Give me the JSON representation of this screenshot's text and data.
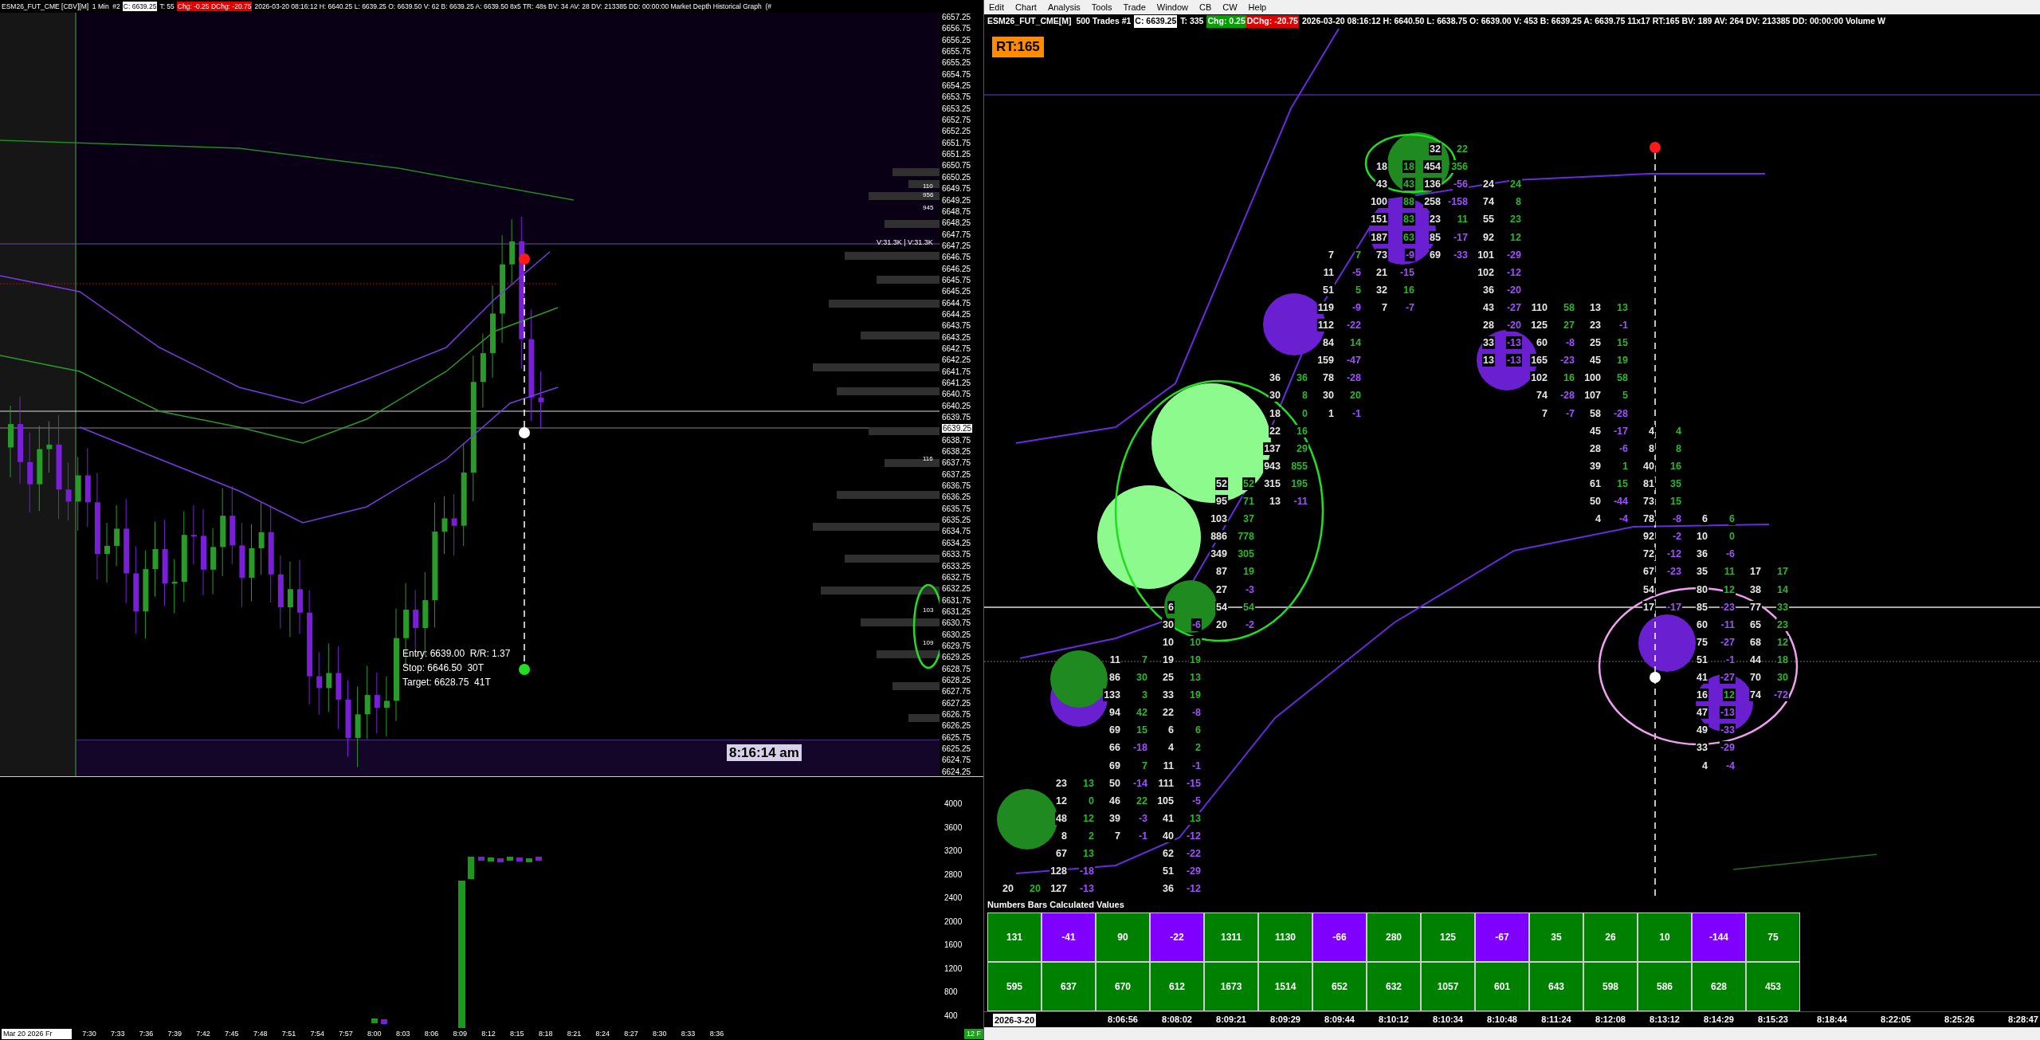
{
  "left_chart": {
    "header": {
      "symbol": "ESM26_FUT_CME [CBV][M]  1 Min  #2",
      "close": "C: 6639.25",
      "trades": "T: 55",
      "change": "Chg: -0.25 DChg: -20.75",
      "details": "2026-03-20 08:16:12 H: 6640.25 L: 6639.25 O: 6639.50 V: 62 B: 6639.25 A: 6639.50 8x5 TR: 48s BV: 34 AV: 28 DV: 213385 DD: 00:00:00 Market Depth Historical Graph  (#"
    },
    "price_axis": [
      {
        "text": "6657.25",
        "highlighted": false
      },
      {
        "text": "6656.75",
        "highlighted": false
      },
      {
        "text": "6656.25",
        "highlighted": false
      },
      {
        "text": "6655.75",
        "highlighted": false
      },
      {
        "text": "6655.25",
        "highlighted": false
      },
      {
        "text": "6654.75",
        "highlighted": false
      },
      {
        "text": "6654.25",
        "highlighted": false
      },
      {
        "text": "6653.75",
        "highlighted": false
      },
      {
        "text": "6653.25",
        "highlighted": false
      },
      {
        "text": "6652.75",
        "highlighted": false
      },
      {
        "text": "6652.25",
        "highlighted": false
      },
      {
        "text": "6651.75",
        "highlighted": false
      },
      {
        "text": "6651.25",
        "highlighted": false
      },
      {
        "text": "6650.75",
        "highlighted": false
      },
      {
        "text": "6650.25",
        "highlighted": false
      },
      {
        "text": "6649.75",
        "highlighted": false
      },
      {
        "text": "6649.25",
        "highlighted": false
      },
      {
        "text": "6648.75",
        "highlighted": false
      },
      {
        "text": "6648.25",
        "highlighted": false
      },
      {
        "text": "6647.75",
        "highlighted": false
      },
      {
        "text": "6647.25",
        "highlighted": false
      },
      {
        "text": "6646.75",
        "highlighted": false
      },
      {
        "text": "6646.25",
        "highlighted": false
      },
      {
        "text": "6645.75",
        "highlighted": false
      },
      {
        "text": "6645.25",
        "highlighted": false
      },
      {
        "text": "6644.75",
        "highlighted": false
      },
      {
        "text": "6644.25",
        "highlighted": false
      },
      {
        "text": "6643.75",
        "highlighted": false
      },
      {
        "text": "6643.25",
        "highlighted": false
      },
      {
        "text": "6642.75",
        "highlighted": false
      },
      {
        "text": "6642.25",
        "highlighted": false
      },
      {
        "text": "6641.75",
        "highlighted": false
      },
      {
        "text": "6641.25",
        "highlighted": false
      },
      {
        "text": "6640.75",
        "highlighted": false
      },
      {
        "text": "6640.25",
        "highlighted": false
      },
      {
        "text": "6639.75",
        "highlighted": false
      },
      {
        "text": "6639.25",
        "highlighted": true
      },
      {
        "text": "6638.75",
        "highlighted": false
      },
      {
        "text": "6638.25",
        "highlighted": false
      },
      {
        "text": "6637.75",
        "highlighted": false
      },
      {
        "text": "6637.25",
        "highlighted": false
      },
      {
        "text": "6636.75",
        "highlighted": false
      },
      {
        "text": "6636.25",
        "highlighted": false
      },
      {
        "text": "6635.75",
        "highlighted": false
      },
      {
        "text": "6635.25",
        "highlighted": false
      },
      {
        "text": "6634.75",
        "highlighted": false
      },
      {
        "text": "6634.25",
        "highlighted": false
      },
      {
        "text": "6633.75",
        "highlighted": false
      },
      {
        "text": "6633.25",
        "highlighted": false
      },
      {
        "text": "6632.75",
        "highlighted": false
      },
      {
        "text": "6632.25",
        "highlighted": false
      },
      {
        "text": "6631.75",
        "highlighted": false
      },
      {
        "text": "6631.25",
        "highlighted": false
      },
      {
        "text": "6630.75",
        "highlighted": false
      },
      {
        "text": "6630.25",
        "highlighted": false
      },
      {
        "text": "6629.75",
        "highlighted": false
      },
      {
        "text": "6629.25",
        "highlighted": false
      },
      {
        "text": "6628.75",
        "highlighted": false
      },
      {
        "text": "6628.25",
        "highlighted": false
      },
      {
        "text": "6627.75",
        "highlighted": false
      },
      {
        "text": "6627.25",
        "highlighted": false
      },
      {
        "text": "6626.75",
        "highlighted": false
      },
      {
        "text": "6626.25",
        "highlighted": false
      },
      {
        "text": "6625.75",
        "highlighted": false
      },
      {
        "text": "6625.25",
        "highlighted": false
      },
      {
        "text": "6624.75",
        "highlighted": false
      },
      {
        "text": "6624.25",
        "highlighted": false
      }
    ],
    "depth_labels": [
      "110",
      "956",
      "945",
      "116",
      "103",
      "109"
    ],
    "volume_label": "V:31.3K | V:31.3K",
    "order_info": [
      "Entry: 6639.00  R/R: 1.37",
      "Stop: 6646.50  30T",
      "Target: 6628.75  41T"
    ],
    "time_box": "8:16:14 am",
    "volume_axis": [
      "4000",
      "3600",
      "3200",
      "2800",
      "2400",
      "2000",
      "1600",
      "1200",
      "800",
      "400"
    ],
    "time_axis": {
      "date": "Mar 20 2026 Fr",
      "times": [
        "7:30",
        "7:33",
        "7:36",
        "7:39",
        "7:42",
        "7:45",
        "7:48",
        "7:51",
        "7:54",
        "7:57",
        "8:00",
        "8:03",
        "8:06",
        "8:09",
        "8:12",
        "8:15",
        "8:18",
        "8:21",
        "8:24",
        "8:27",
        "8:30",
        "8:33",
        "8:36"
      ],
      "tag": "12 F"
    }
  },
  "right_chart": {
    "menu": [
      "Edit",
      "Chart",
      "Analysis",
      "Tools",
      "Trade",
      "Window",
      "CB",
      "CW",
      "Help"
    ],
    "header": {
      "symbol": "ESM26_FUT_CME[M]  500 Trades #1",
      "close": "C: 6639.25",
      "trades": "T: 335",
      "change": "Chg: 0.25",
      "daily_change": "DChg: -20.75",
      "details": "2026-03-20 08:16:12 H: 6640.50 L: 6638.75 O: 6639.00 V: 453 B: 6639.25 A: 6639.75 11x17 RT:165 BV: 189 AV: 264 DV: 213385 DD: 00:00:00 Volume W"
    },
    "rt_badge": "RT:165",
    "bars": [
      {
        "cells": [
          null,
          null,
          null,
          null,
          null,
          null,
          null,
          null,
          null,
          null,
          null,
          null,
          null,
          null,
          null,
          null,
          null,
          null,
          null,
          null,
          null,
          null,
          null,
          null,
          null,
          null,
          null,
          null,
          null,
          null,
          null,
          null,
          null,
          null,
          null,
          null,
          null,
          null,
          null,
          null,
          null,
          null,
          [
            "20",
            "20",
            true
          ]
        ]
      },
      {
        "cells": [
          null,
          null,
          null,
          null,
          null,
          null,
          null,
          null,
          null,
          null,
          null,
          null,
          null,
          null,
          null,
          null,
          null,
          null,
          null,
          null,
          null,
          null,
          null,
          null,
          null,
          null,
          null,
          null,
          null,
          null,
          null,
          null,
          null,
          null,
          null,
          null,
          [
            "23",
            "13",
            true
          ],
          [
            "12",
            "0",
            true
          ],
          [
            "48",
            "12",
            true
          ],
          [
            "8",
            "2",
            true
          ],
          [
            "67",
            "13",
            true
          ],
          [
            "128",
            "-18",
            false
          ],
          [
            "127",
            "-13",
            false
          ]
        ]
      },
      {
        "cells": [
          null,
          null,
          null,
          null,
          null,
          null,
          null,
          null,
          null,
          null,
          null,
          null,
          null,
          null,
          null,
          null,
          null,
          null,
          null,
          null,
          null,
          null,
          null,
          null,
          null,
          null,
          null,
          null,
          null,
          [
            "11",
            "7",
            true
          ],
          [
            "86",
            "30",
            true
          ],
          [
            "133",
            "3",
            true
          ],
          [
            "94",
            "42",
            true
          ],
          [
            "69",
            "15",
            true
          ],
          [
            "66",
            "-18",
            false
          ],
          [
            "69",
            "7",
            true
          ],
          [
            "50",
            "-14",
            false
          ],
          [
            "46",
            "22",
            true
          ],
          [
            "39",
            "-3",
            false
          ],
          [
            "7",
            "-1",
            false
          ]
        ]
      },
      {
        "cells": [
          null,
          null,
          null,
          null,
          null,
          null,
          null,
          null,
          null,
          null,
          null,
          null,
          null,
          null,
          null,
          null,
          null,
          null,
          null,
          null,
          null,
          null,
          null,
          null,
          null,
          null,
          [
            "6"
          ],
          [
            "30",
            "-6",
            false
          ],
          [
            "10",
            "10",
            true
          ],
          [
            "19",
            "19",
            true
          ],
          [
            "25",
            "13",
            true
          ],
          [
            "33",
            "19",
            true
          ],
          [
            "22",
            "-8",
            false
          ],
          [
            "6",
            "6",
            true
          ],
          [
            "4",
            "2",
            true
          ],
          [
            "11",
            "-1",
            false
          ],
          [
            "111",
            "-15",
            false
          ],
          [
            "105",
            "-5",
            false
          ],
          [
            "41",
            "13",
            true
          ],
          [
            "40",
            "-12",
            false
          ],
          [
            "62",
            "-22",
            false
          ],
          [
            "51",
            "-29",
            false
          ],
          [
            "36",
            "-12",
            false
          ]
        ]
      },
      {
        "cells": [
          null,
          null,
          null,
          null,
          null,
          null,
          null,
          null,
          null,
          null,
          null,
          null,
          null,
          null,
          null,
          null,
          null,
          null,
          null,
          [
            "52",
            "52",
            true
          ],
          [
            "95",
            "71",
            true
          ],
          [
            "103",
            "37",
            true
          ],
          [
            "886",
            "778",
            true
          ],
          [
            "349",
            "305",
            true
          ],
          [
            "87",
            "19",
            true
          ],
          [
            "27",
            "-3",
            false
          ],
          [
            "54",
            "54",
            true
          ],
          [
            "20",
            "-2",
            false
          ]
        ]
      },
      {
        "cells": [
          null,
          null,
          null,
          null,
          null,
          null,
          null,
          null,
          null,
          null,
          null,
          null,
          null,
          [
            "36",
            "36",
            true
          ],
          [
            "30",
            "8",
            true
          ],
          [
            "18",
            "0",
            true
          ],
          [
            "22",
            "16",
            true
          ],
          [
            "137",
            "29",
            true
          ],
          [
            "943",
            "855",
            true
          ],
          [
            "315",
            "195",
            true
          ],
          [
            "13",
            "-11",
            false
          ]
        ]
      },
      {
        "cells": [
          null,
          null,
          null,
          null,
          null,
          null,
          [
            "7",
            "7",
            true
          ],
          [
            "11",
            "-5",
            false
          ],
          [
            "51",
            "5",
            true
          ],
          [
            "119",
            "-9",
            false
          ],
          [
            "112",
            "-22",
            false
          ],
          [
            "84",
            "14",
            true
          ],
          [
            "159",
            "-47",
            false
          ],
          [
            "78",
            "-28",
            false
          ],
          [
            "30",
            "20",
            true
          ],
          [
            "1",
            "-1",
            false
          ]
        ]
      },
      {
        "cells": [
          null,
          [
            "18",
            "18",
            true
          ],
          [
            "43",
            "43",
            true
          ],
          [
            "100",
            "88",
            true
          ],
          [
            "151",
            "83",
            true
          ],
          [
            "187",
            "63",
            true
          ],
          [
            "73",
            "-9",
            false
          ],
          [
            "21",
            "-15",
            false
          ],
          [
            "32",
            "16",
            true
          ],
          [
            "7",
            "-7",
            false
          ]
        ]
      },
      {
        "cells": [
          [
            "32",
            "22",
            true
          ],
          [
            "454",
            "356",
            true
          ],
          [
            "136",
            "-56",
            false
          ],
          [
            "258",
            "-158",
            false
          ],
          [
            "23",
            "11",
            true
          ],
          [
            "85",
            "-17",
            false
          ],
          [
            "69",
            "-33",
            false
          ]
        ]
      },
      {
        "cells": [
          null,
          null,
          [
            "24",
            "24",
            true
          ],
          [
            "74",
            "8",
            true
          ],
          [
            "55",
            "23",
            true
          ],
          [
            "92",
            "12",
            true
          ],
          [
            "101",
            "-29",
            false
          ],
          [
            "102",
            "-12",
            false
          ],
          [
            "36",
            "-20",
            false
          ],
          [
            "43",
            "-27",
            false
          ],
          [
            "28",
            "-20",
            false
          ],
          [
            "33",
            "-13",
            false
          ],
          [
            "13",
            "-13",
            false
          ]
        ]
      },
      {
        "cells": [
          null,
          null,
          null,
          null,
          null,
          null,
          null,
          null,
          null,
          [
            "110",
            "58",
            true
          ],
          [
            "125",
            "27",
            true
          ],
          [
            "60",
            "-8",
            false
          ],
          [
            "165",
            "-23",
            false
          ],
          [
            "102",
            "16",
            true
          ],
          [
            "74",
            "-28",
            false
          ],
          [
            "7",
            "-7",
            false
          ]
        ]
      },
      {
        "cells": [
          null,
          null,
          null,
          null,
          null,
          null,
          null,
          null,
          null,
          [
            "13",
            "13",
            true
          ],
          [
            "23",
            "-1",
            false
          ],
          [
            "25",
            "15",
            true
          ],
          [
            "45",
            "19",
            true
          ],
          [
            "100",
            "58",
            true
          ],
          [
            "107",
            "5",
            true
          ],
          [
            "58",
            "-28",
            false
          ],
          [
            "45",
            "-17",
            false
          ],
          [
            "28",
            "-6",
            false
          ],
          [
            "39",
            "1",
            true
          ],
          [
            "61",
            "15",
            true
          ],
          [
            "50",
            "-44",
            false
          ],
          [
            "4",
            "-4",
            false
          ]
        ]
      },
      {
        "cells": [
          null,
          null,
          null,
          null,
          null,
          null,
          null,
          null,
          null,
          null,
          null,
          null,
          null,
          null,
          null,
          null,
          [
            "4",
            "4",
            true
          ],
          [
            "8",
            "8",
            true
          ],
          [
            "40",
            "16",
            true
          ],
          [
            "81",
            "35",
            true
          ],
          [
            "73",
            "15",
            true
          ],
          [
            "78",
            "-8",
            false
          ],
          [
            "92",
            "-2",
            false
          ],
          [
            "72",
            "-12",
            false
          ],
          [
            "67",
            "-23",
            false
          ],
          [
            "54"
          ],
          [
            "17",
            "-17",
            false
          ]
        ]
      },
      {
        "cells": [
          null,
          null,
          null,
          null,
          null,
          null,
          null,
          null,
          null,
          null,
          null,
          null,
          null,
          null,
          null,
          null,
          null,
          null,
          null,
          null,
          null,
          [
            "6",
            "6",
            true
          ],
          [
            "10",
            "0",
            true
          ],
          [
            "36",
            "-6",
            false
          ],
          [
            "35",
            "11",
            true
          ],
          [
            "80",
            "12",
            true
          ],
          [
            "85",
            "-23",
            false
          ],
          [
            "60",
            "-11",
            false
          ],
          [
            "75",
            "-27",
            false
          ],
          [
            "51",
            "-1",
            false
          ],
          [
            "41",
            "-27",
            false
          ],
          [
            "16",
            "12",
            true
          ],
          [
            "47",
            "-13",
            false
          ],
          [
            "49",
            "-33",
            false
          ],
          [
            "33",
            "-29",
            false
          ],
          [
            "4",
            "-4",
            false
          ]
        ]
      },
      {
        "cells": [
          null,
          null,
          null,
          null,
          null,
          null,
          null,
          null,
          null,
          null,
          null,
          null,
          null,
          null,
          null,
          null,
          null,
          null,
          null,
          null,
          null,
          null,
          null,
          null,
          [
            "17",
            "17",
            true
          ],
          [
            "38",
            "14",
            true
          ],
          [
            "77",
            "33",
            true
          ],
          [
            "65",
            "23",
            true
          ],
          [
            "68",
            "12",
            true
          ],
          [
            "44",
            "18",
            true
          ],
          [
            "70",
            "30",
            true
          ],
          [
            "74",
            "-72",
            false
          ]
        ]
      }
    ],
    "table": {
      "title": "Numbers Bars Calculated Values",
      "row_1": [
        {
          "text": "131",
          "color": "#008000"
        },
        {
          "text": "-41",
          "color": "#8000ff"
        },
        {
          "text": "90",
          "color": "#008000"
        },
        {
          "text": "-22",
          "color": "#8000ff"
        },
        {
          "text": "1311",
          "color": "#008000"
        },
        {
          "text": "1130",
          "color": "#008000"
        },
        {
          "text": "-66",
          "color": "#8000ff"
        },
        {
          "text": "280",
          "color": "#008000"
        },
        {
          "text": "125",
          "color": "#008000"
        },
        {
          "text": "-67",
          "color": "#8000ff"
        },
        {
          "text": "35",
          "color": "#008000"
        },
        {
          "text": "26",
          "color": "#008000"
        },
        {
          "text": "10",
          "color": "#008000"
        },
        {
          "text": "-144",
          "color": "#8000ff"
        },
        {
          "text": "75",
          "color": "#008000"
        }
      ],
      "row_2": [
        "595",
        "637",
        "670",
        "612",
        "1673",
        "1514",
        "652",
        "632",
        "1057",
        "601",
        "643",
        "598",
        "586",
        "628",
        "453"
      ]
    },
    "time_axis": {
      "date": "2026-3-20",
      "times": [
        "8:06:56",
        "8:08:02",
        "8:09:21",
        "8:09:29",
        "8:09:44",
        "8:10:12",
        "8:10:34",
        "8:10:48",
        "8:11:24",
        "8:12:08",
        "8:13:12",
        "8:14:29",
        "8:15:23"
      ],
      "more_times": [
        "8:18:44",
        "8:22:05",
        "8:25:26",
        "8:28:47"
      ]
    }
  }
}
